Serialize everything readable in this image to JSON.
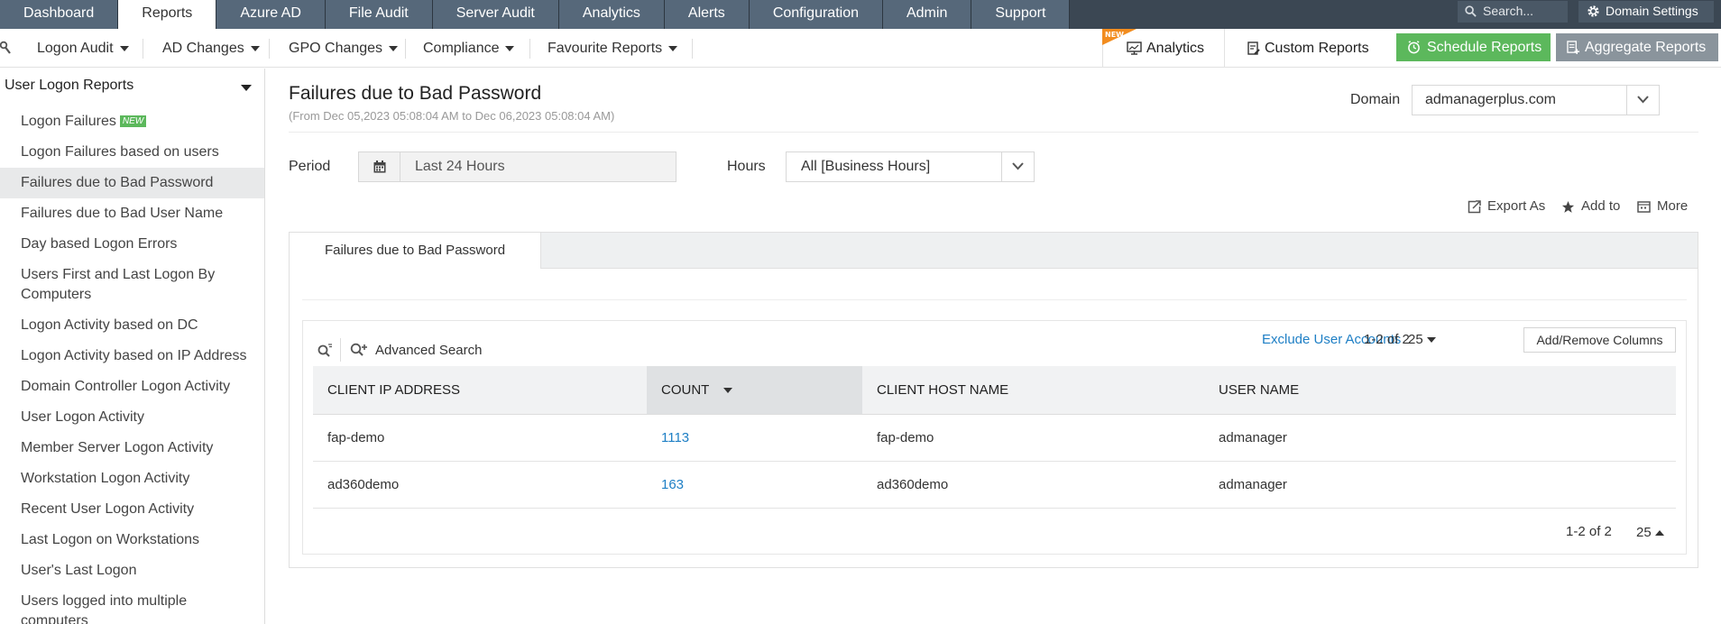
{
  "topnav": {
    "tabs": [
      "Dashboard",
      "Reports",
      "Azure AD",
      "File Audit",
      "Server Audit",
      "Analytics",
      "Alerts",
      "Configuration",
      "Admin",
      "Support"
    ],
    "active_tab": "Reports",
    "search_placeholder": "Search...",
    "domain_settings": "Domain Settings"
  },
  "subnav": {
    "logon_audit": "Logon Audit",
    "ad_changes": "AD Changes",
    "gpo_changes": "GPO Changes",
    "compliance": "Compliance",
    "favourite_reports": "Favourite Reports",
    "new_ribbon": "NEW",
    "analytics": "Analytics",
    "custom_reports": "Custom Reports",
    "schedule_reports": "Schedule Reports",
    "aggregate_reports": "Aggregate Reports"
  },
  "sidebar": {
    "header": "User Logon Reports",
    "new_badge": "NEW",
    "items": [
      "Logon Failures",
      "Logon Failures based on users",
      "Failures due to Bad Password",
      "Failures due to Bad User Name",
      "Day based Logon Errors",
      "Users First and Last Logon By Computers",
      "Logon Activity based on DC",
      "Logon Activity based on IP Address",
      "Domain Controller Logon Activity",
      "User Logon Activity",
      "Member Server Logon Activity",
      "Workstation Logon Activity",
      "Recent User Logon Activity",
      "Last Logon on Workstations",
      "User's Last Logon",
      "Users logged into multiple computers"
    ],
    "active_index": 2
  },
  "main": {
    "title": "Failures due to Bad Password",
    "subtitle": "(From Dec 05,2023 05:08:04 AM to Dec 06,2023 05:08:04 AM)",
    "domain_label": "Domain",
    "domain_value": "admanagerplus.com",
    "period_label": "Period",
    "period_value": "Last 24 Hours",
    "hours_label": "Hours",
    "hours_value": "All [Business Hours]",
    "export_as": "Export As",
    "add_to": "Add to",
    "more": "More",
    "panel_tab": "Failures due to Bad Password",
    "advanced_search": "Advanced Search",
    "exclude_user_accounts": "Exclude User Accounts",
    "pagination": "1-2 of 2",
    "per_page": "25",
    "add_remove_columns": "Add/Remove Columns"
  },
  "table": {
    "columns": [
      "CLIENT IP ADDRESS",
      "COUNT",
      "CLIENT HOST NAME",
      "USER NAME"
    ],
    "rows": [
      [
        "fap-demo",
        "1113",
        "fap-demo",
        "admanager"
      ],
      [
        "ad360demo",
        "163",
        "ad360demo",
        "admanager"
      ]
    ]
  },
  "colors": {
    "topnav_bg": "#3b4753",
    "tab_bg": "#56687a",
    "accent_link": "#1e7fc5",
    "schedule_green": "#5cb85c",
    "aggregate_gray": "#8a949c",
    "new_ribbon": "#f28c1e"
  }
}
